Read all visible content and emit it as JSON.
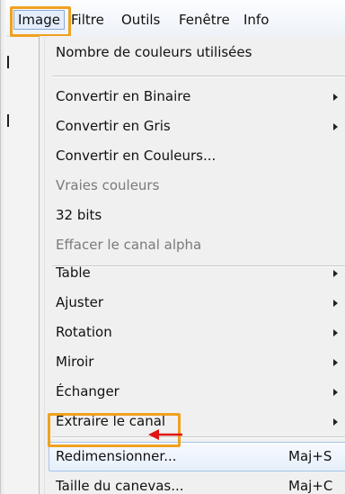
{
  "menubar": {
    "items": [
      {
        "label": "Image"
      },
      {
        "label": "Filtre"
      },
      {
        "label": "Outils"
      },
      {
        "label": "Fenêtre"
      },
      {
        "label": "Info"
      }
    ]
  },
  "menu": {
    "items": [
      {
        "label": "Nombre de couleurs utilisées"
      },
      {
        "label": "Convertir en Binaire",
        "submenu": true
      },
      {
        "label": "Convertir en Gris",
        "submenu": true
      },
      {
        "label": "Convertir en Couleurs..."
      },
      {
        "label": "Vraies couleurs",
        "disabled": true
      },
      {
        "label": "32 bits"
      },
      {
        "label": "Effacer le canal alpha",
        "disabled": true
      },
      {
        "label": "Table",
        "submenu": true
      },
      {
        "label": "Ajuster",
        "submenu": true
      },
      {
        "label": "Rotation",
        "submenu": true
      },
      {
        "label": "Miroir",
        "submenu": true
      },
      {
        "label": "Échanger",
        "submenu": true
      },
      {
        "label": "Extraire le canal",
        "submenu": true
      },
      {
        "label": "Redimensionner...",
        "shortcut": "Maj+S",
        "hovered": true
      },
      {
        "label": "Taille du canevas...",
        "shortcut": "Maj+C"
      }
    ]
  },
  "colors": {
    "highlight": "#f0a11f",
    "arrow": "#e01414"
  },
  "icons": {
    "submenu": "chevron-right-icon",
    "callout": "red-arrow-left-icon"
  }
}
